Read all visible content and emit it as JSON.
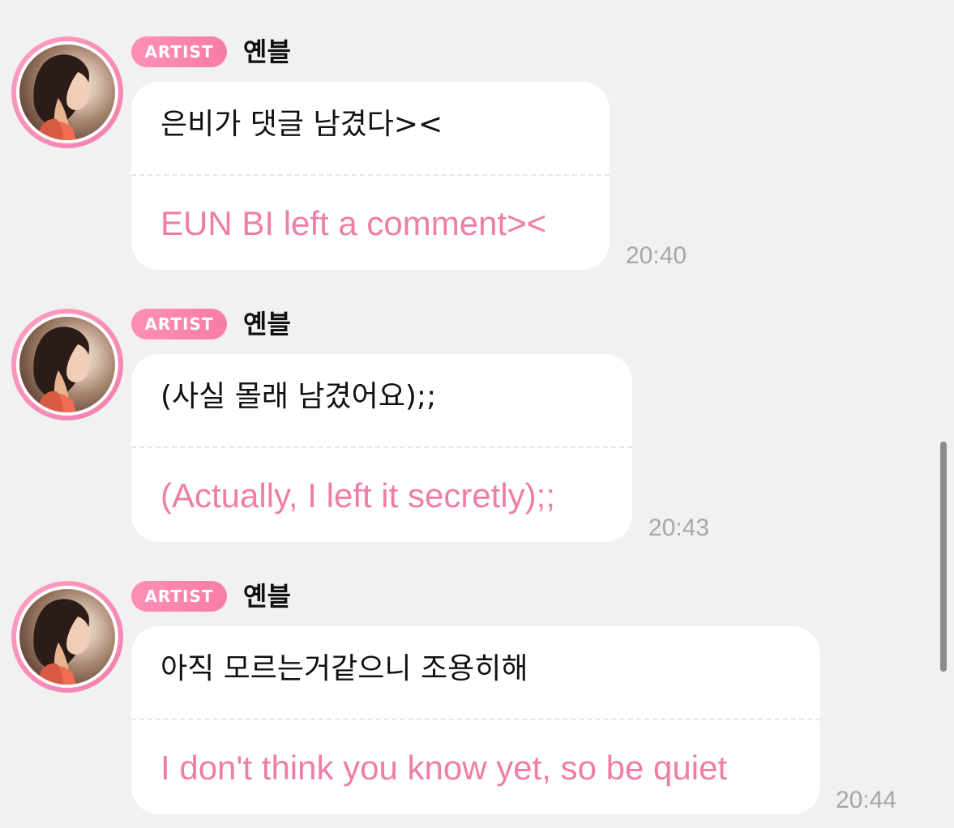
{
  "chat": {
    "messages": [
      {
        "badge": "ARTIST",
        "author": "옌블",
        "korean": "은비가 댓글 남겼다><",
        "english": "EUN BI left a comment><",
        "time": "20:40",
        "avatar_icon": "artist-avatar"
      },
      {
        "badge": "ARTIST",
        "author": "옌블",
        "korean": "(사실 몰래 남겼어요);;",
        "english": "(Actually, I left it secretly);;",
        "time": "20:43",
        "avatar_icon": "artist-avatar"
      },
      {
        "badge": "ARTIST",
        "author": "옌블",
        "korean": "아직 모르는거같으니 조용히해",
        "english": "I don't think you know yet, so be quiet",
        "time": "20:44",
        "avatar_icon": "artist-avatar"
      }
    ]
  },
  "colors": {
    "background": "#f1f1f1",
    "bubble": "#ffffff",
    "badge": "#f77da5",
    "english_text": "#ef7ea5",
    "timestamp": "#a7a7a7"
  }
}
